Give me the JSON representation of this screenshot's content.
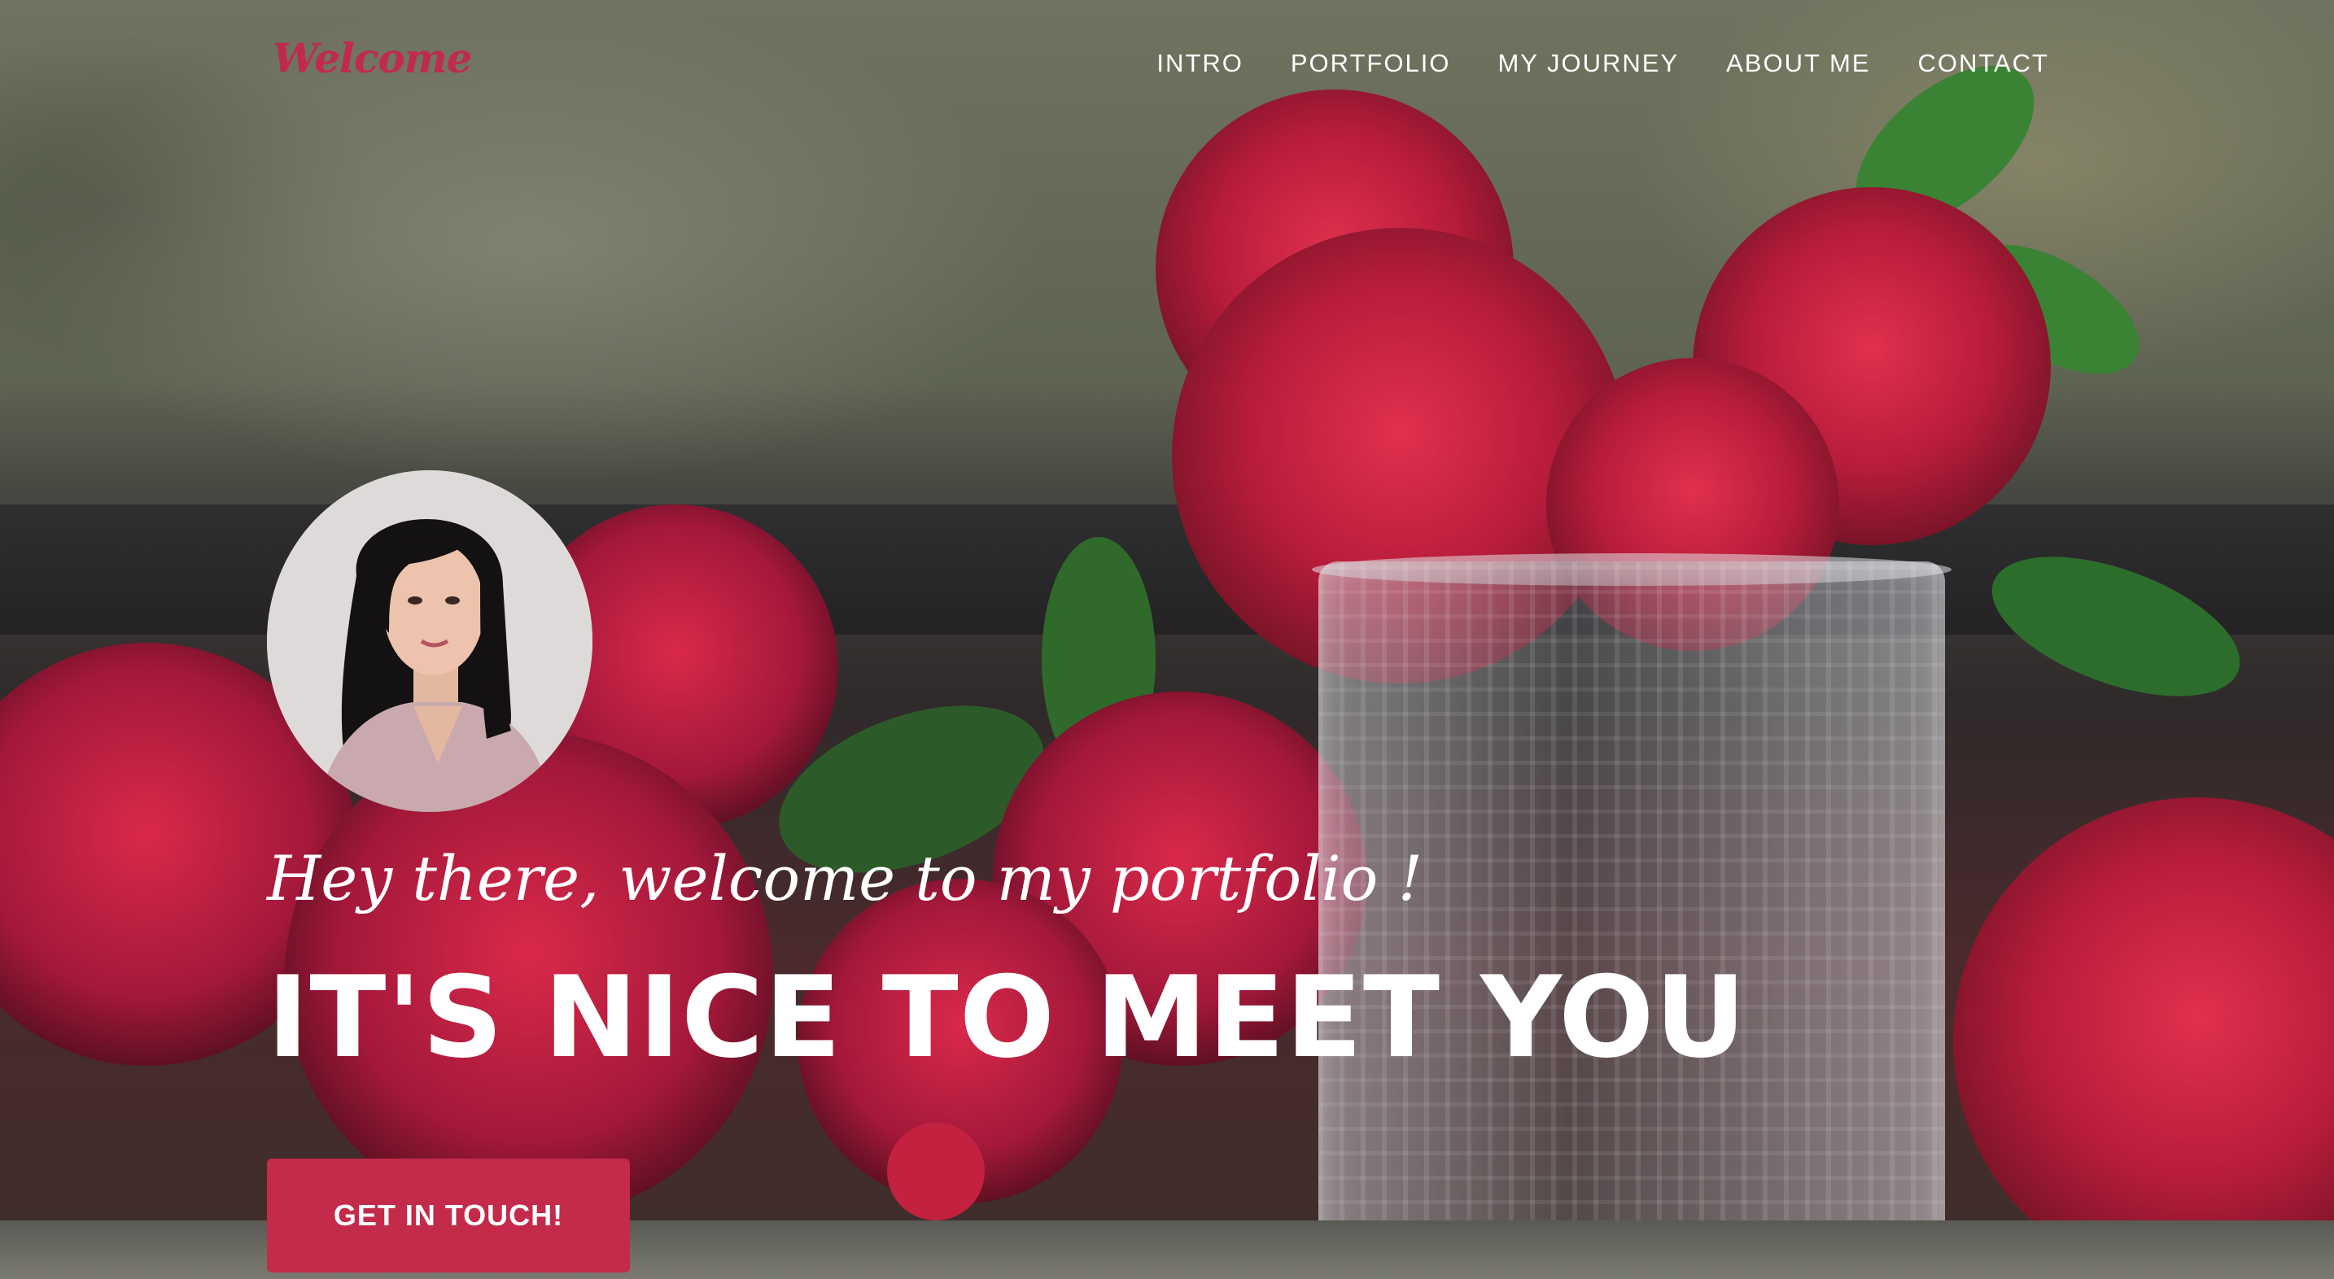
{
  "header": {
    "brand": "Welcome",
    "nav": [
      "INTRO",
      "PORTFOLIO",
      "MY JOURNEY",
      "ABOUT ME",
      "CONTACT"
    ]
  },
  "hero": {
    "subtitle": "Hey there, welcome to my portfolio !",
    "title": "IT'S NICE TO MEET YOU",
    "cta_label": "GET IN TOUCH!"
  },
  "colors": {
    "accent": "#c42a4a",
    "brand_text": "#c12a4a",
    "text": "#ffffff"
  }
}
